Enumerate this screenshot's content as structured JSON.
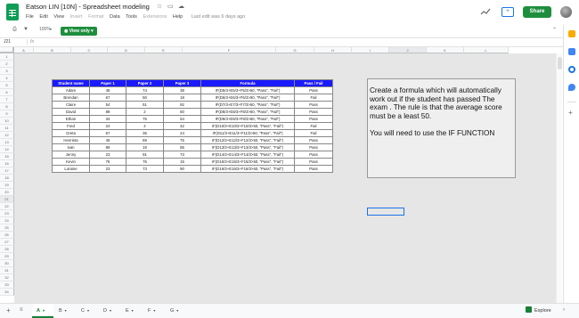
{
  "header": {
    "doc_title": "Eatson LIN [10N] - Spreadsheet modeling",
    "menus": [
      "File",
      "Edit",
      "View",
      "Insert",
      "Format",
      "Data",
      "Tools",
      "Extensions",
      "Help"
    ],
    "menus_dimmed": [
      "Insert",
      "Format",
      "Extensions"
    ],
    "last_edit": "Last edit was 6 days ago",
    "share_label": "Share",
    "accent_color": "#1e8e3e"
  },
  "toolbar": {
    "zoom": "100%",
    "view_only_label": "View only"
  },
  "formula_bar": {
    "name_box": "J21",
    "formula": "fx"
  },
  "columns": [
    "A",
    "B",
    "C",
    "D",
    "E",
    "F",
    "G",
    "H",
    "I",
    "J",
    "K",
    "L"
  ],
  "rows": [
    "1",
    "2",
    "3",
    "4",
    "5",
    "6",
    "7",
    "8",
    "9",
    "10",
    "11",
    "12",
    "13",
    "14",
    "15",
    "16",
    "17",
    "18",
    "19",
    "20",
    "21",
    "22",
    "23",
    "24",
    "25",
    "26",
    "27",
    "28",
    "29",
    "30",
    "31",
    "32",
    "33",
    "34"
  ],
  "selected_cell": {
    "column": "J",
    "row": "21"
  },
  "table": {
    "headers": [
      "Student name",
      "Paper 1",
      "Paper 2",
      "Paper 3",
      "Formula",
      "Pass / Fail"
    ],
    "rows": [
      [
        "Adam",
        "45",
        "74",
        "38",
        "IF(D5/3+E5/3+F5/3>50, \"Pass\", \"Fail\")",
        "Pass"
      ],
      [
        "Brendan",
        "67",
        "50",
        "18",
        "IF(D6/3+E6/3+F6/3>50, \"Pass\", \"Fail\")",
        "Fail"
      ],
      [
        "Claire",
        "54",
        "51",
        "92",
        "IF(D7/3+E7/3+F7/3>50, \"Pass\", \"Fail\")",
        "Pass"
      ],
      [
        "David",
        "89",
        "2",
        "60",
        "IF(D8/3+E8/3+F8/3>50, \"Pass\", \"Fail\")",
        "Pass"
      ],
      [
        "Ethan",
        "34",
        "75",
        "54",
        "IF(D9/3+E9/3+F9/3>50, \"Pass\", \"Fail\")",
        "Pass"
      ],
      [
        "Fred",
        "24",
        "4",
        "42",
        "IF(D10/3+E10/3+F10/3>50, \"Pass\", \"Fail\")",
        "Fail"
      ],
      [
        "Greta",
        "67",
        "36",
        "24",
        "IF(D11/3+E11/3+F11/3>50, \"Pass\", \"Fail\")",
        "Fail"
      ],
      [
        "Henrieta",
        "45",
        "69",
        "75",
        "IF(D12/3+E12/3+F12/3>50, \"Pass\", \"Fail\")",
        "Pass"
      ],
      [
        "Ivan",
        "89",
        "19",
        "85",
        "IF(D13/3+E13/3+F13/3>50, \"Pass\", \"Fail\")",
        "Pass"
      ],
      [
        "Jenny",
        "23",
        "91",
        "73",
        "IF(D14/3+E14/3+F14/3>50, \"Pass\", \"Fail\")",
        "Pass"
      ],
      [
        "Kevin",
        "76",
        "76",
        "15",
        "IF(D15/3+E15/3+F15/3>50, \"Pass\", \"Fail\")",
        "Pass"
      ],
      [
        "Loraine",
        "23",
        "73",
        "90",
        "IF(D16/3+E16/3+F16/3>50, \"Pass\", \"Fail\")",
        "Pass"
      ]
    ],
    "header_color": "#1a1aff"
  },
  "instructions": {
    "para1": "Create a formula which will automatically work out if the student has passed The exam . The rule is that the average score must be a least 50.",
    "para2": "You will need to use the IF FUNCTION"
  },
  "sheets": {
    "tabs": [
      "A",
      "B",
      "C",
      "D",
      "E",
      "F",
      "G"
    ],
    "active": "A",
    "explore_label": "Explore"
  }
}
